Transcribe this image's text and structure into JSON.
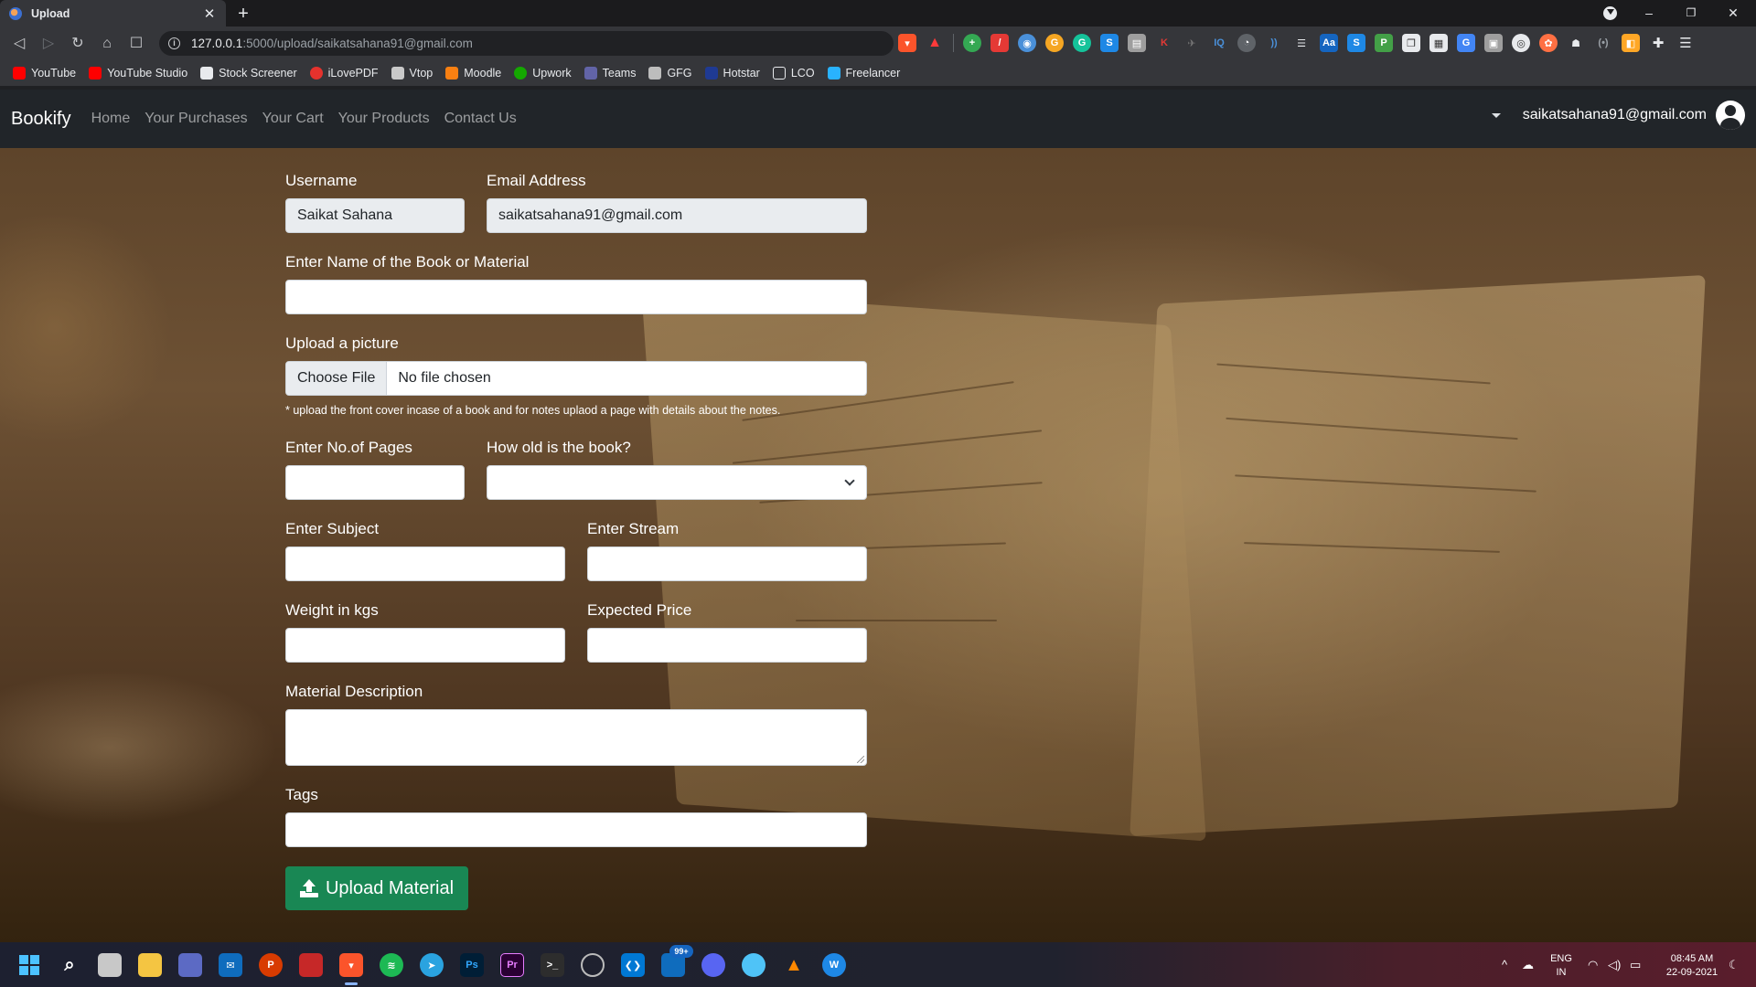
{
  "browser": {
    "tab_title": "Upload",
    "tab_close": "✕",
    "new_tab": "+",
    "url_host": "127.0.0.1",
    "url_path": ":5000/upload/saikatsahana91@gmail.com",
    "window_controls": {
      "minimize": "–",
      "restore": "❐",
      "close": "✕"
    },
    "bookmarks": [
      {
        "label": "YouTube",
        "icon": "youtube-icon",
        "color": "#ff0000"
      },
      {
        "label": "YouTube Studio",
        "icon": "youtube-studio-icon",
        "color": "#ff0000"
      },
      {
        "label": "Stock Screener",
        "icon": "stock-screener-icon",
        "color": "#e8eaed"
      },
      {
        "label": "iLovePDF",
        "icon": "ilovepdf-icon",
        "color": "#e5322d"
      },
      {
        "label": "Vtop",
        "icon": "vtop-icon",
        "color": "#c9c9c9"
      },
      {
        "label": "Moodle",
        "icon": "moodle-icon",
        "color": "#f98012"
      },
      {
        "label": "Upwork",
        "icon": "upwork-icon",
        "color": "#14a800"
      },
      {
        "label": "Teams",
        "icon": "teams-icon",
        "color": "#6264a7"
      },
      {
        "label": "GFG",
        "icon": "gfg-icon",
        "color": "#bdbdbd"
      },
      {
        "label": "Hotstar",
        "icon": "hotstar-icon",
        "color": "#1f3a93"
      },
      {
        "label": "LCO",
        "icon": "lco-icon",
        "color": "#e8eaed"
      },
      {
        "label": "Freelancer",
        "icon": "freelancer-icon",
        "color": "#29b2fe"
      }
    ]
  },
  "navbar": {
    "brand": "Bookify",
    "links": [
      "Home",
      "Your Purchases",
      "Your Cart",
      "Your Products",
      "Contact Us"
    ],
    "user_email": "saikatsahana91@gmail.com"
  },
  "form": {
    "username_label": "Username",
    "username_value": "Saikat Sahana",
    "email_label": "Email Address",
    "email_value": "saikatsahana91@gmail.com",
    "book_name_label": "Enter Name of the Book or Material",
    "picture_label": "Upload a picture",
    "choose_file": "Choose File",
    "no_file": "No file chosen",
    "picture_hint": "* upload the front cover incase of a book and for notes uplaod a page with details about the notes.",
    "pages_label": "Enter No.of Pages",
    "age_label": "How old is the book?",
    "subject_label": "Enter Subject",
    "stream_label": "Enter Stream",
    "weight_label": "Weight in kgs",
    "price_label": "Expected Price",
    "description_label": "Material Description",
    "tags_label": "Tags",
    "submit_label": "Upload Material"
  },
  "taskbar": {
    "language_line1": "ENG",
    "language_line2": "IN",
    "time": "08:45 AM",
    "date": "22-09-2021",
    "badge": "99+"
  },
  "colors": {
    "navbar_bg": "#212529",
    "submit_bg": "#198754",
    "input_disabled_bg": "#e9ecef"
  }
}
